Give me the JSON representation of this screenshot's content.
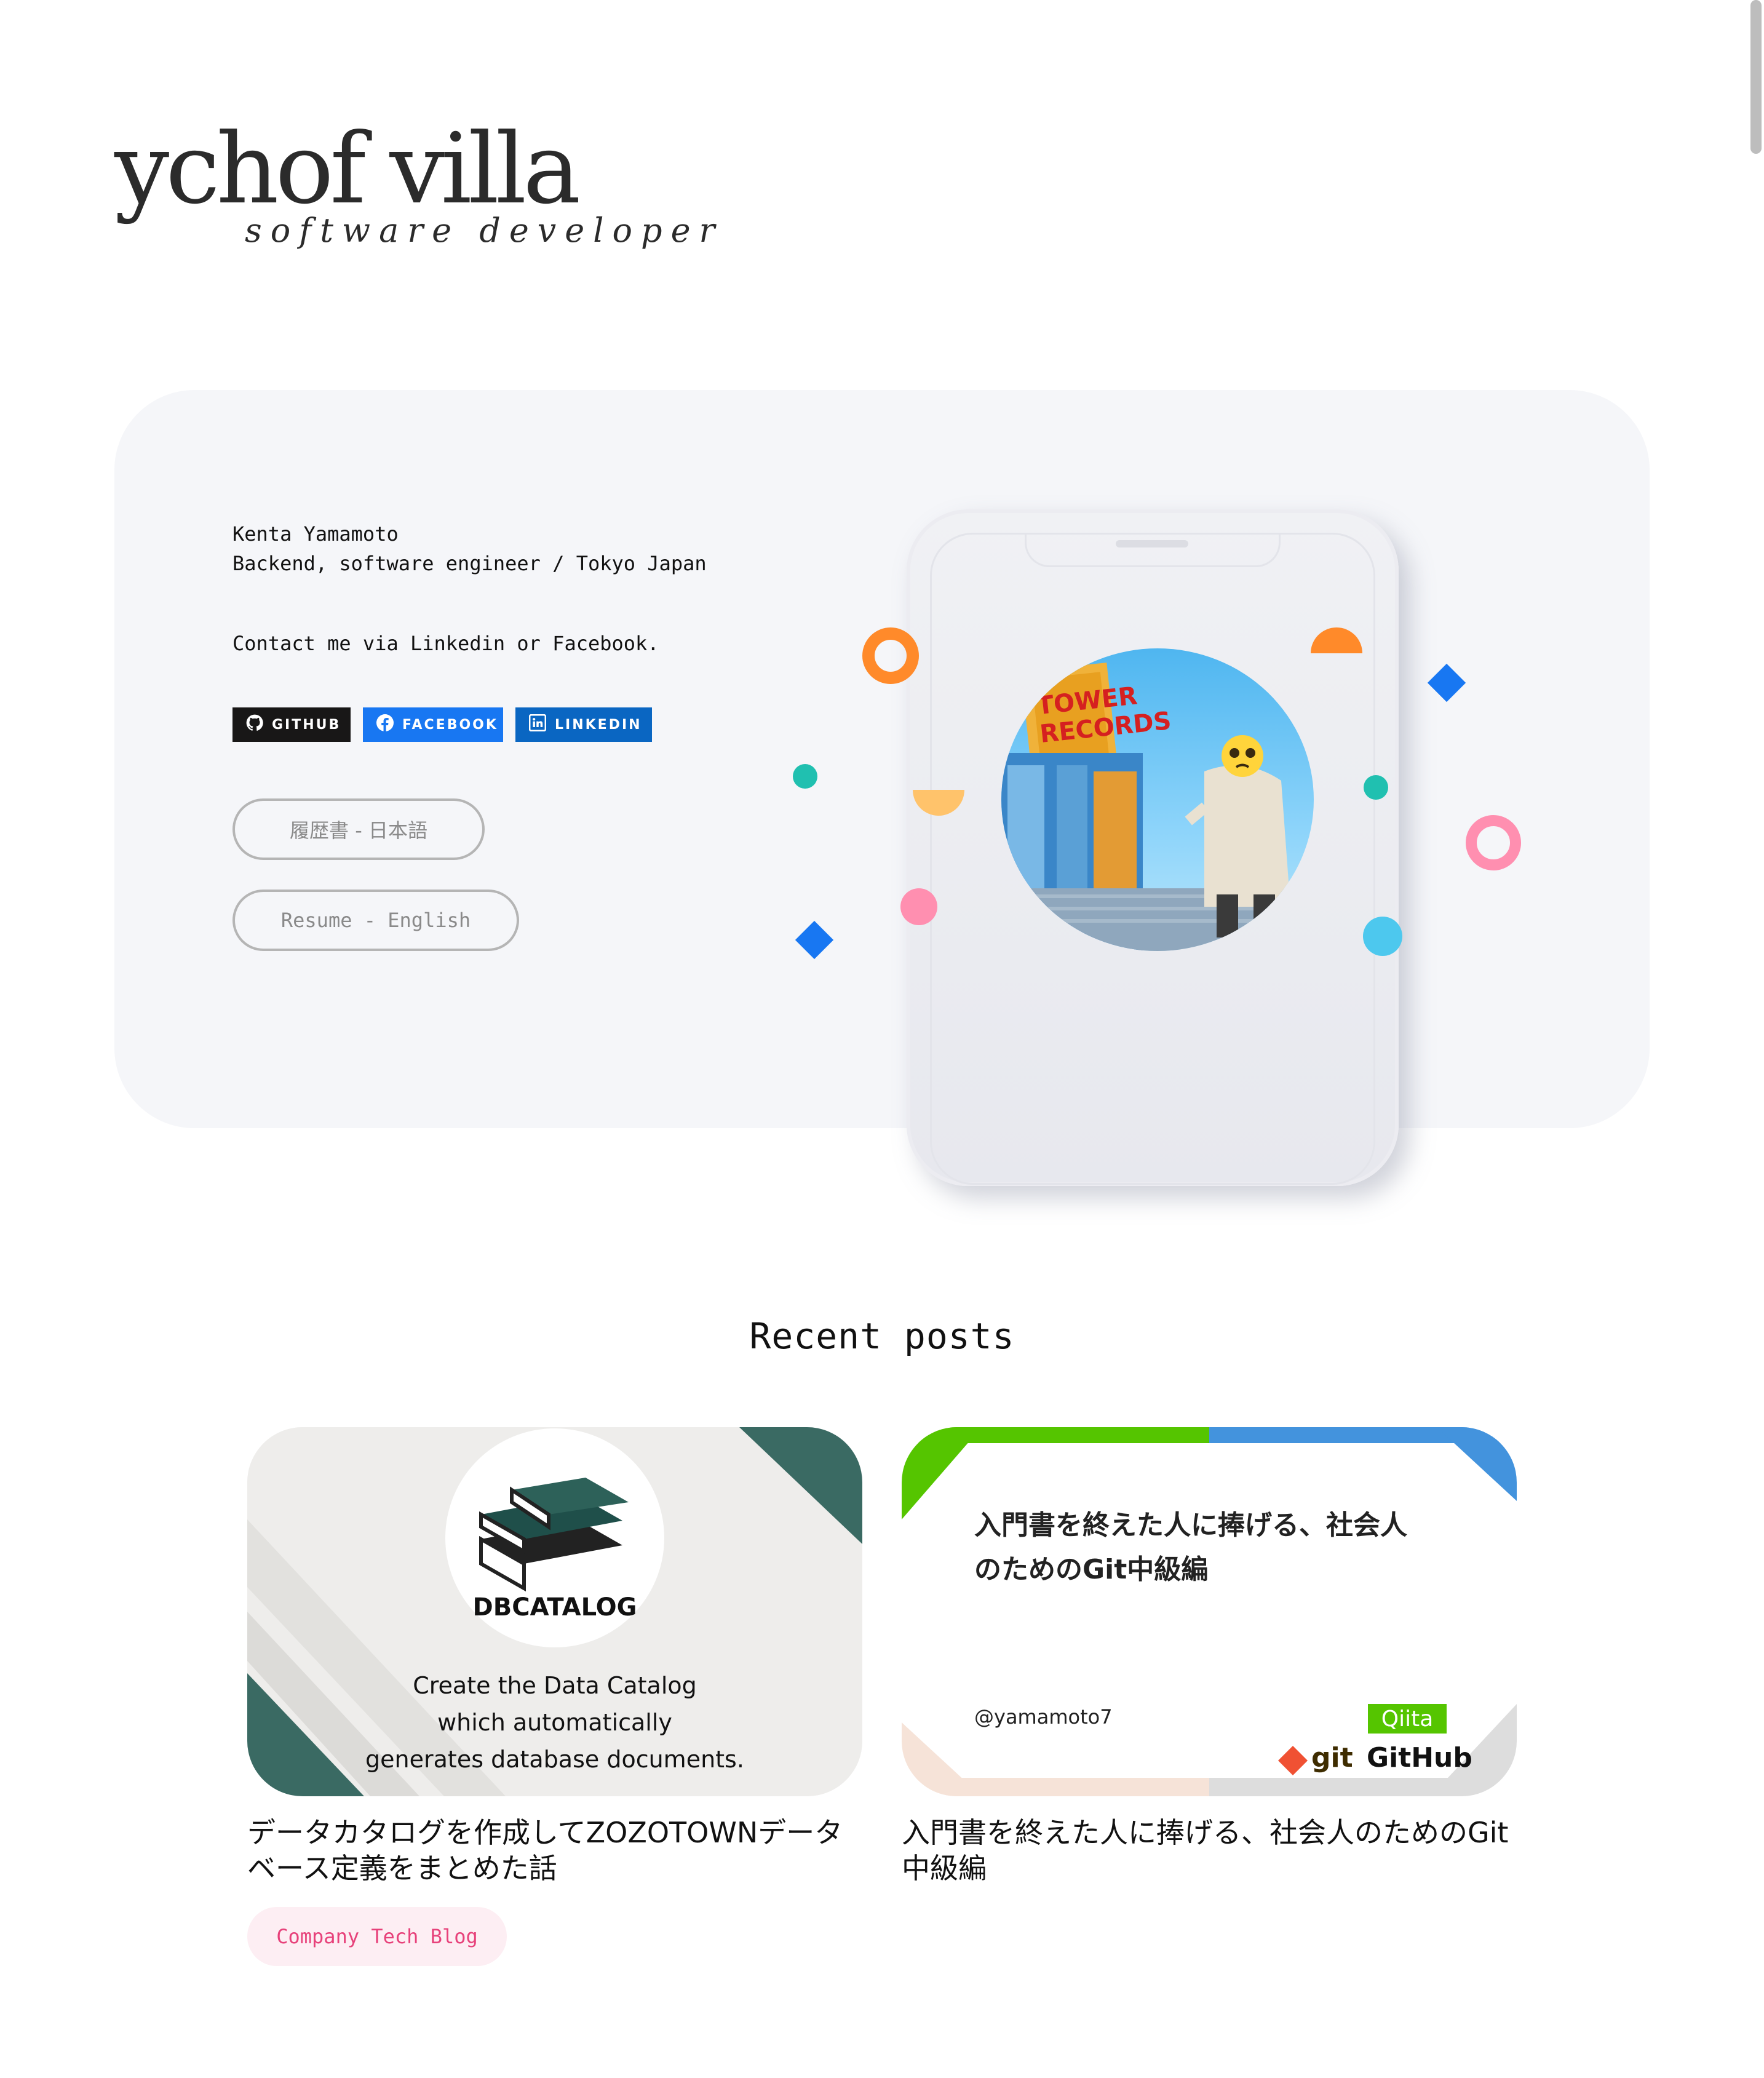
{
  "logo": {
    "main": "ychof villa",
    "sub": "software developer"
  },
  "profile": {
    "name": "Kenta Yamamoto",
    "role": "Backend, software engineer / Tokyo Japan",
    "contact": "Contact me via Linkedin or Facebook."
  },
  "social": {
    "github": "GITHUB",
    "facebook": "FACEBOOK",
    "linkedin": "LINKEDIN"
  },
  "resume": {
    "japanese": "履歴書 - 日本語",
    "english": "Resume - English"
  },
  "photo": {
    "sign_line1": "TOWER",
    "sign_line2": "RECORDS"
  },
  "colors": {
    "github": "#181717",
    "facebook": "#1877f2",
    "linkedin": "#0a66c2",
    "tag_text": "#e7417a",
    "tag_bg": "#fdeef3",
    "hero_bg": "#f5f6f9"
  },
  "recent_posts": {
    "heading": "Recent posts",
    "posts": [
      {
        "title": "データカタログを作成してZOZOTOWNデータベース定義をまとめた話",
        "tag": "Company Tech Blog",
        "thumbnail": {
          "logo_text": "DBCATALOG",
          "line1": "Create the Data Catalog",
          "line2": "which automatically",
          "line3": "generates database documents."
        }
      },
      {
        "title": "入門書を終えた人に捧げる、社会人のためのGit中級編",
        "thumbnail": {
          "heading_line1": "入門書を終えた人に捧げる、社会人",
          "heading_line2": "のためのGit中級編",
          "author": "@yamamoto7",
          "badge_qiita": "Qiita",
          "badge_git": "git",
          "badge_github": "GitHub"
        }
      }
    ]
  }
}
